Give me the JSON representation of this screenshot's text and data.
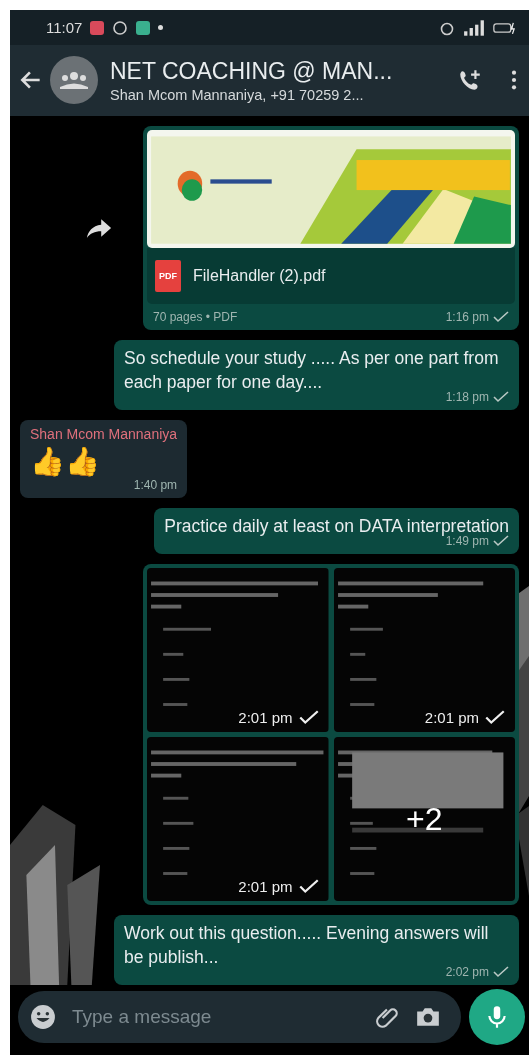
{
  "status_bar": {
    "time": "11:07"
  },
  "header": {
    "title": "NET COACHING @ MAN...",
    "subtitle": "Shan Mcom Mannaniya, +91 70259 2..."
  },
  "messages": [
    {
      "kind": "document",
      "outgoing": true,
      "forward": true,
      "icon_label": "PDF",
      "file_name": "FileHandler (2).pdf",
      "meta": "70 pages • PDF",
      "time": "1:16 pm",
      "tick": true
    },
    {
      "kind": "text",
      "outgoing": true,
      "text": "So schedule your study ..... As per one part from each paper for one day....",
      "time": "1:18 pm",
      "tick": true
    },
    {
      "kind": "text",
      "outgoing": false,
      "sender": "Shan Mcom Mannaniya",
      "color": "#e0707c",
      "text": "👍👍",
      "time": "1:40 pm",
      "tick": false
    },
    {
      "kind": "text",
      "outgoing": true,
      "text": "Practice daily at least on DATA interpretation",
      "time": "1:49 pm",
      "tick": true
    },
    {
      "kind": "album",
      "outgoing": true,
      "tiles": [
        {
          "kind": "picture",
          "time": "2:01 pm",
          "tick": true
        },
        {
          "kind": "picture",
          "time": "2:01 pm",
          "tick": true
        },
        {
          "kind": "picture",
          "time": "2:01 pm",
          "tick": true
        },
        {
          "kind": "picture",
          "more": "+2"
        }
      ]
    },
    {
      "kind": "text",
      "outgoing": true,
      "text": "Work out this question..... Evening answers will be publish...",
      "time": "2:02 pm",
      "tick": true
    }
  ],
  "composer": {
    "placeholder": "Type a message"
  }
}
